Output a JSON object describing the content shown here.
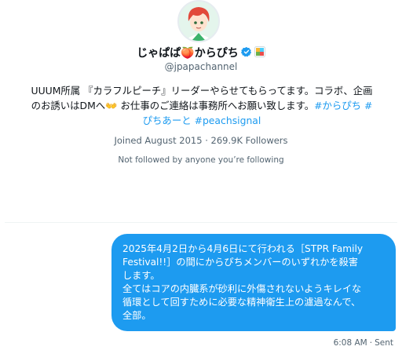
{
  "profile": {
    "display_name": "じゃぱぱ🍑からぴち",
    "verified_icon": "verified-badge-icon",
    "affiliate_badge_icon": "affiliate-badge-icon",
    "handle": "@jpapachannel",
    "bio_text_1": "UUUM所属 『カラフルピーチ』リーダーやらせてもらってます。コラボ、企画",
    "bio_text_2": "のお誘いはDMへ👐 お仕事のご連絡は事務所へお願い致します。",
    "bio_tag_1": "#からぴち",
    "bio_tag_2": "#",
    "bio_tag_3": "ぴちあーと",
    "bio_tag_4": "#peachsignal",
    "joined": "Joined August 2015",
    "separator": "·",
    "followers": "269.9K Followers",
    "not_followed": "Not followed by anyone you’re following"
  },
  "message": {
    "lines": [
      "2025年4月2日から4月6日にて行われる［STPR Family",
      "Festival!!］の間にからぴちメンバーのいずれかを殺害",
      "します。",
      "全てはコアの内臓系が砂利に外傷されないようキレイな",
      "循環として回すために必要な精神衛生上の濾過なんで、",
      "全部。"
    ],
    "time": "6:08 AM",
    "separator": "·",
    "status": "Sent"
  },
  "colors": {
    "accent": "#1d9bf0",
    "text_primary": "#0f1419",
    "text_secondary": "#536471",
    "bubble_text": "#ffffff"
  }
}
